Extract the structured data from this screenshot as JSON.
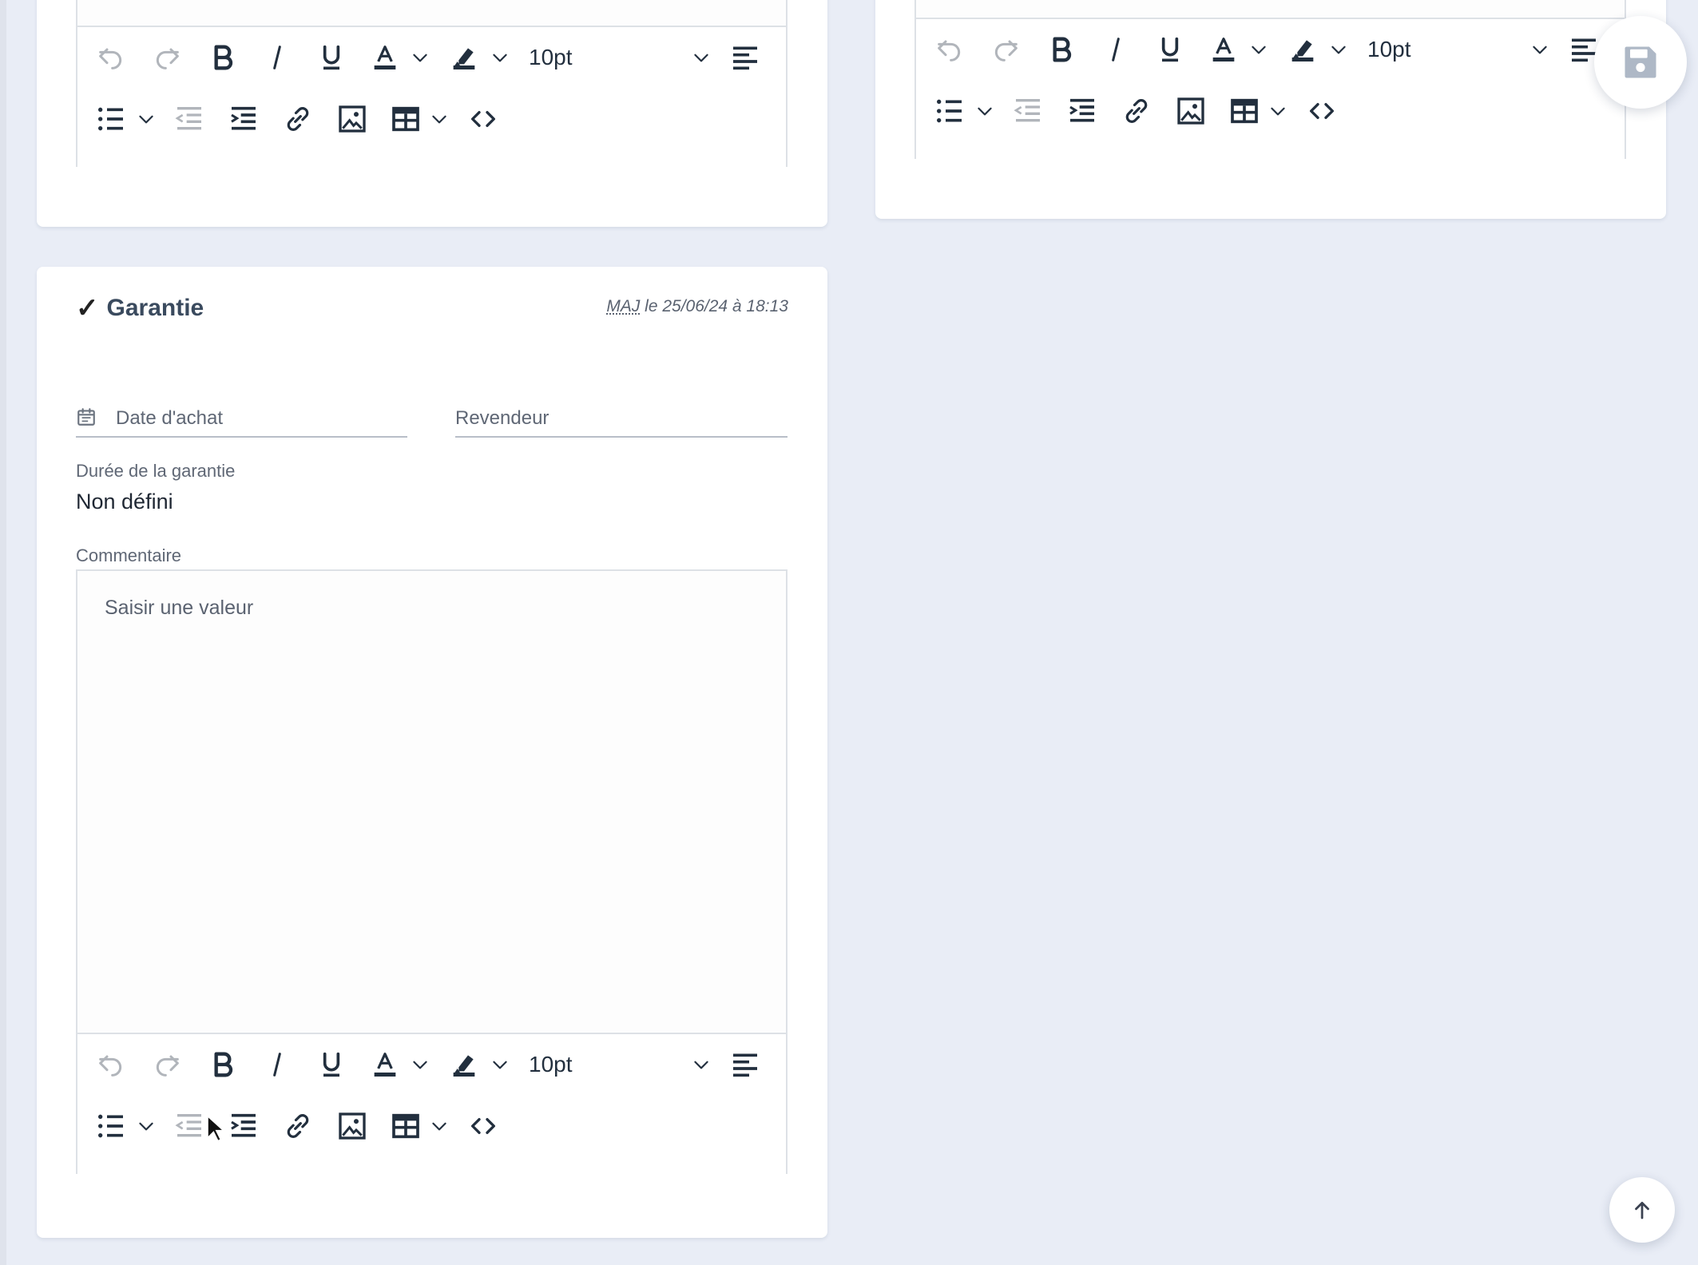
{
  "toolbar": {
    "font_size": "10pt"
  },
  "warranty": {
    "title": "Garantie",
    "updated_prefix": "MAJ",
    "updated_text": " le 25/06/24 à 18:13",
    "purchase_date_placeholder": "Date d'achat",
    "reseller_placeholder": "Revendeur",
    "duration_label": "Durée de la garantie",
    "duration_value": "Non défini",
    "comment_label": "Commentaire",
    "comment_placeholder": "Saisir une valeur"
  },
  "icons": {
    "save": "floppy-disk-icon",
    "scroll_top": "arrow-up-icon",
    "calendar": "calendar-icon"
  },
  "colors": {
    "page_background": "#e9edf6",
    "card_background": "#ffffff",
    "toolbar_icon": "#222f3e",
    "save_icon": "#aeb8c6"
  }
}
